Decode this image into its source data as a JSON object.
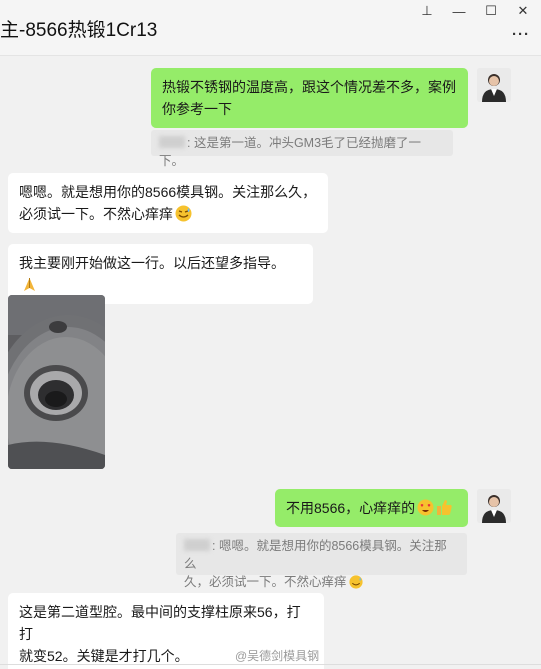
{
  "window": {
    "title": "主-8566热锻1Cr13",
    "pin_glyph": "⊥",
    "minimize_glyph": "—",
    "maximize_glyph": "☐",
    "close_glyph": "✕",
    "more_glyph": "···"
  },
  "messages": {
    "m1_line1": "热锻不锈钢的温度高，跟这个情况差不多，案例",
    "m1_line2": "你参考一下",
    "q1_text": ": 这是第一道。冲头GM3毛了已经抛磨了一下。",
    "m2_line1": "嗯嗯。就是想用你的8566模具钢。关注那么久，",
    "m2_line2": "必须试一下。不然心痒痒",
    "m3_text": "我主要刚开始做这一行。以后还望多指导。",
    "m4_text": "不用8566，心痒痒的",
    "q2_line1": ": 嗯嗯。就是想用你的8566模具钢。关注那么",
    "q2_line2": "久，必须试一下。不然心痒痒",
    "m5_line1": "这是第二道型腔。最中间的支撑柱原来56，打打",
    "m5_line2": "就变52。关键是才打几个。"
  },
  "watermark": "@吴德剑模具钢",
  "colors": {
    "self_bubble": "#95ec69",
    "other_bubble": "#ffffff",
    "background": "#f1f1f1"
  },
  "icons": [
    "pin-icon",
    "minimize-icon",
    "maximize-icon",
    "close-icon",
    "more-icon",
    "emoji-sweat-icon",
    "emoji-pray-icon",
    "emoji-heart-eyes-icon",
    "emoji-thumbs-up-icon"
  ]
}
